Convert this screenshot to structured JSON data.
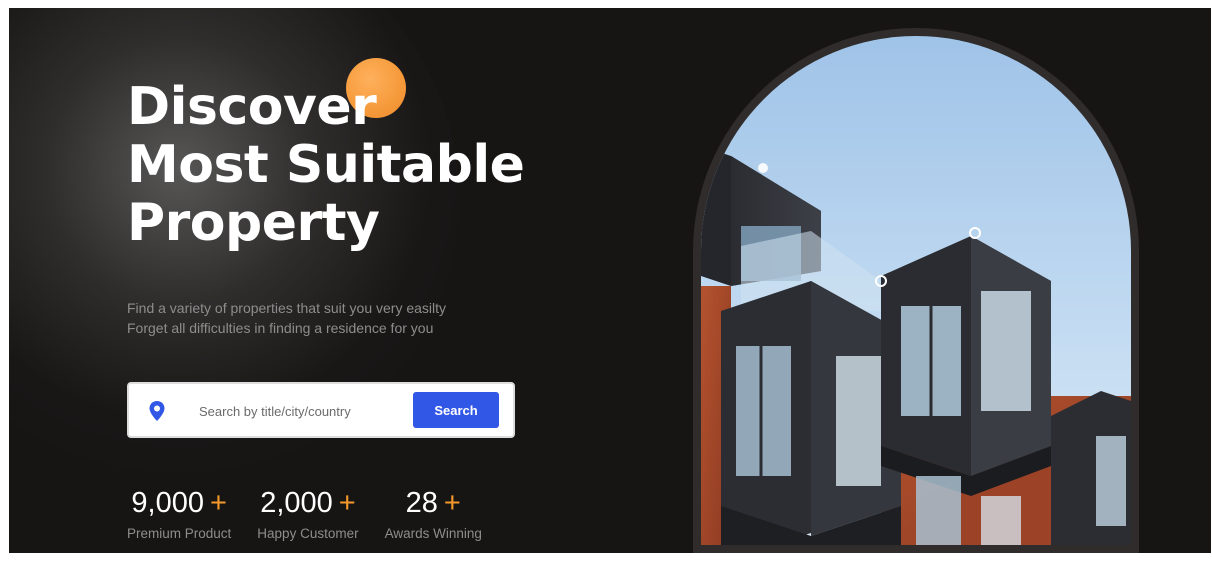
{
  "hero": {
    "title_lines": [
      "Discover",
      "Most Suitable",
      "Property"
    ],
    "subtitle_lines": [
      "Find a variety of properties that suit you very easilty",
      "Forget all difficulties in finding a residence for you"
    ]
  },
  "search": {
    "placeholder": "Search by title/city/country",
    "button_label": "Search",
    "icon": "location-pin-icon"
  },
  "stats": [
    {
      "value": "9,000",
      "plus": "+",
      "label": "Premium Product"
    },
    {
      "value": "2,000",
      "plus": "+",
      "label": "Happy Customer"
    },
    {
      "value": "28",
      "plus": "+",
      "label": "Awards Winning"
    }
  ],
  "colors": {
    "background": "#171514",
    "accent_orange": "#f59a2a",
    "button_blue": "#3157e6"
  }
}
